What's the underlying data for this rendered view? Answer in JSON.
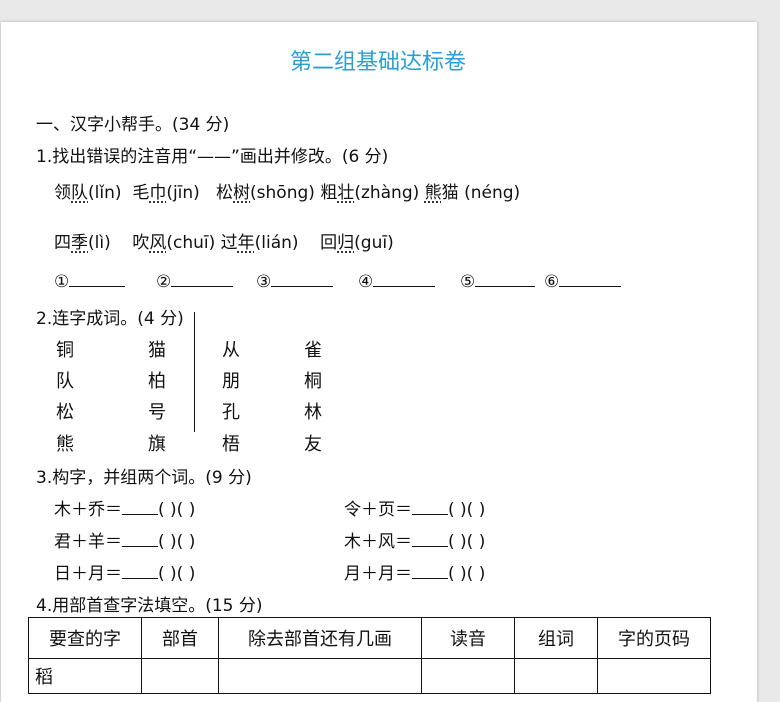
{
  "title": "第二组基础达标卷",
  "section1": {
    "heading": "一、汉字小帮手。(34 分)"
  },
  "q1": {
    "prompt": "1.找出错误的注音用“——”画出并修改。(6 分)",
    "row1": [
      {
        "pre": "领",
        "dot": "队",
        "py": "(lǐn)"
      },
      {
        "pre": "毛",
        "dot": "巾",
        "py": "(jīn)"
      },
      {
        "pre": "松",
        "dot": "树",
        "py": "(shōng)"
      },
      {
        "pre": "粗",
        "dot": "壮",
        "py": "(zhàng)"
      },
      {
        "pre": "",
        "dot": "熊",
        "py": "猫  (néng)"
      }
    ],
    "row2": [
      {
        "pre": "四",
        "dot": "季",
        "py": "(lì)"
      },
      {
        "pre": "吹",
        "dot": "风",
        "py": "(chuī)"
      },
      {
        "pre": "过",
        "dot": "年",
        "py": "(lián)"
      },
      {
        "pre": "回",
        "dot": "归",
        "py": "(guī)"
      }
    ],
    "blanks": [
      "①",
      "②",
      "③",
      "④",
      "⑤",
      "⑥"
    ]
  },
  "q2": {
    "prompt": "2.连字成词。(4 分)",
    "grid": [
      [
        "铜",
        "猫",
        "从",
        "雀"
      ],
      [
        "队",
        "柏",
        "朋",
        "桐"
      ],
      [
        "松",
        "号",
        "孔",
        "林"
      ],
      [
        "熊",
        "旗",
        "梧",
        "友"
      ]
    ]
  },
  "q3": {
    "prompt": "3.构字，并组两个词。(9 分)",
    "left": [
      "木＋乔＝",
      "君＋羊＝",
      "日＋月＝"
    ],
    "right": [
      "令＋页＝",
      "木＋风＝",
      "月＋月＝"
    ],
    "paren": "(        )(        )"
  },
  "q4": {
    "prompt": "4.用部首查字法填空。(15 分)",
    "headers": [
      "要查的字",
      "部首",
      "除去部首还有几画",
      "读音",
      "组词",
      "字的页码"
    ],
    "rows": [
      [
        "稻",
        "",
        "",
        "",
        "",
        ""
      ]
    ]
  }
}
